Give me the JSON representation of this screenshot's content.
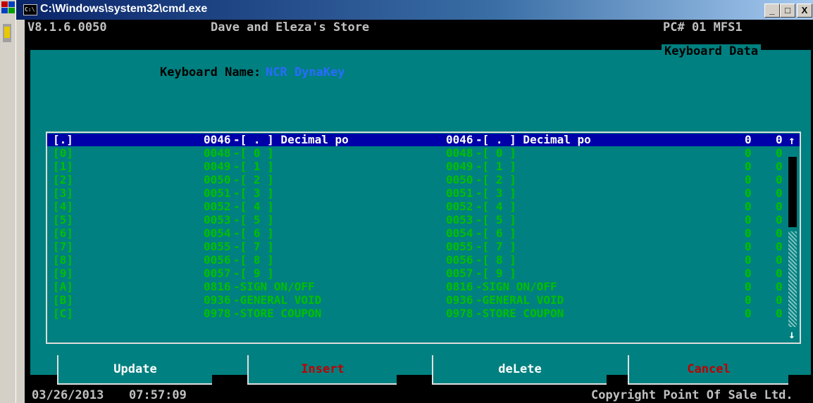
{
  "window": {
    "title": "C:\\Windows\\system32\\cmd.exe",
    "buttons": {
      "minimize": "_",
      "maximize": "□",
      "close": "X"
    }
  },
  "header": {
    "version": "V8.1.6.0050",
    "store": "Dave and Eleza's Store",
    "pc": "PC# 01 MFS1",
    "screen": "Keyboard Data"
  },
  "keyboard": {
    "label": "Keyboard Name:",
    "name": "NCR DynaKey"
  },
  "rows": [
    {
      "key": "[.]",
      "code1": "0046",
      "desc1": "-[ . ] Decimal po",
      "code2": "0046",
      "desc2": "-[ . ] Decimal po",
      "v1": "0",
      "v2": "0"
    },
    {
      "key": "[0]",
      "code1": "0048",
      "desc1": "-[ 0 ]",
      "code2": "0048",
      "desc2": "-[ 0 ]",
      "v1": "0",
      "v2": "0"
    },
    {
      "key": "[1]",
      "code1": "0049",
      "desc1": "-[ 1 ]",
      "code2": "0049",
      "desc2": "-[ 1 ]",
      "v1": "0",
      "v2": "0"
    },
    {
      "key": "[2]",
      "code1": "0050",
      "desc1": "-[ 2 ]",
      "code2": "0050",
      "desc2": "-[ 2 ]",
      "v1": "0",
      "v2": "0"
    },
    {
      "key": "[3]",
      "code1": "0051",
      "desc1": "-[ 3 ]",
      "code2": "0051",
      "desc2": "-[ 3 ]",
      "v1": "0",
      "v2": "0"
    },
    {
      "key": "[4]",
      "code1": "0052",
      "desc1": "-[ 4 ]",
      "code2": "0052",
      "desc2": "-[ 4 ]",
      "v1": "0",
      "v2": "0"
    },
    {
      "key": "[5]",
      "code1": "0053",
      "desc1": "-[ 5 ]",
      "code2": "0053",
      "desc2": "-[ 5 ]",
      "v1": "0",
      "v2": "0"
    },
    {
      "key": "[6]",
      "code1": "0054",
      "desc1": "-[ 6 ]",
      "code2": "0054",
      "desc2": "-[ 6 ]",
      "v1": "0",
      "v2": "0"
    },
    {
      "key": "[7]",
      "code1": "0055",
      "desc1": "-[ 7 ]",
      "code2": "0055",
      "desc2": "-[ 7 ]",
      "v1": "0",
      "v2": "0"
    },
    {
      "key": "[8]",
      "code1": "0056",
      "desc1": "-[ 8 ]",
      "code2": "0056",
      "desc2": "-[ 8 ]",
      "v1": "0",
      "v2": "0"
    },
    {
      "key": "[9]",
      "code1": "0057",
      "desc1": "-[ 9 ]",
      "code2": "0057",
      "desc2": "-[ 9 ]",
      "v1": "0",
      "v2": "0"
    },
    {
      "key": "[A]",
      "code1": "0816",
      "desc1": "-SIGN ON/OFF",
      "code2": "0816",
      "desc2": "-SIGN ON/OFF",
      "v1": "0",
      "v2": "0"
    },
    {
      "key": "[B]",
      "code1": "0936",
      "desc1": "-GENERAL VOID",
      "code2": "0936",
      "desc2": "-GENERAL VOID",
      "v1": "0",
      "v2": "0"
    },
    {
      "key": "[C]",
      "code1": "0978",
      "desc1": "-STORE COUPON",
      "code2": "0978",
      "desc2": "-STORE COUPON",
      "v1": "0",
      "v2": "0"
    }
  ],
  "buttons": {
    "update": "Update",
    "insert": "Insert",
    "delete": "deLete",
    "cancel": "Cancel"
  },
  "status": {
    "date": "03/26/2013",
    "time": "07:57:09",
    "copyright": "Copyright Point Of Sale Ltd."
  },
  "scrollbar": {
    "up": "↑",
    "down": "↓"
  },
  "colors": {
    "console_bg": "#000000",
    "panel_bg": "#008080",
    "row_text": "#00ff00",
    "selected_row_bg": "#0000a8",
    "keyboard_name": "#2a6bff",
    "warn_button_text": "#c00000"
  }
}
